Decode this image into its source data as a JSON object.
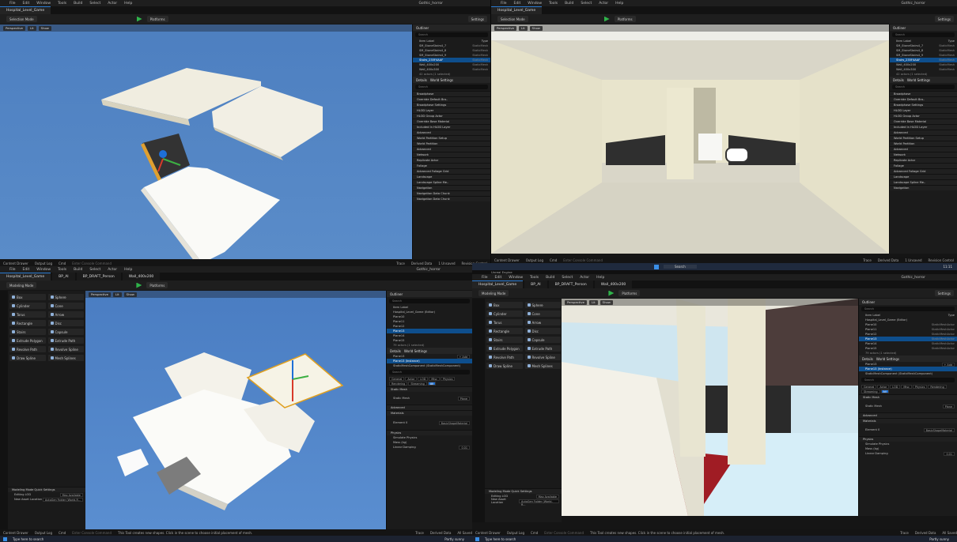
{
  "q1": {
    "menu": [
      "File",
      "Edit",
      "Window",
      "Tools",
      "Build",
      "Select",
      "Actor",
      "Help"
    ],
    "tab": "Hospital_Level_Game",
    "project": "Gothic_horror",
    "toolbar": {
      "mode": "Selection Mode",
      "platforms": "Platforms",
      "settings": "Settings"
    },
    "viewport": {
      "perspective": "Perspective",
      "lit": "Lit",
      "show": "Show"
    },
    "outliner": {
      "title": "Outliner",
      "search": "Search",
      "col_label": "Item Label",
      "col_type": "Type",
      "rows": [
        {
          "label": "SM_StoneStairs4_7",
          "type": "StaticMesh",
          "sel": false
        },
        {
          "label": "SM_StoneStairs4_8",
          "type": "StaticMesh",
          "sel": false
        },
        {
          "label": "SM_StoneStairs4_9",
          "type": "StaticMesh",
          "sel": false
        },
        {
          "label": "Stairs_235F4AAF",
          "type": "StaticMesh",
          "sel": true
        },
        {
          "label": "Wall_400x200",
          "type": "StaticMesh",
          "sel": false
        },
        {
          "label": "Wall_400x300",
          "type": "StaticMesh",
          "sel": false
        }
      ],
      "count": "42 actors (1 selected)"
    },
    "details": {
      "tab1": "Details",
      "tab2": "World Settings",
      "search": "Search",
      "sections": [
        "Broadphase",
        "Override Default Bro..",
        "Broadphase Settings",
        "HLOD Layer",
        "HLOD Group Actor",
        "Override Base Material",
        "Included In HLOD Layer",
        "Advanced",
        "World Partition Setup",
        "World Partition",
        "Advanced",
        "Network",
        "Replicate Actor",
        "Foliage",
        "Advanced Foliage Grid",
        "Landscape",
        "Landscape Spline Me..",
        "Navigation",
        "Navigation Data Chunk",
        "Navigation Data Chunk"
      ],
      "hlod_none": "None",
      "values": [
        "512000",
        "40000"
      ]
    },
    "status": [
      "Content Drawer",
      "Output Log",
      "Cmd",
      "Enter Console Command",
      "Trace",
      "Derived Data",
      "1 Unsaved",
      "Revision Control"
    ]
  },
  "q2": {
    "menu": [
      "File",
      "Edit",
      "Window",
      "Tools",
      "Build",
      "Select",
      "Actor",
      "Help"
    ],
    "tab": "Hospital_Level_Game",
    "project": "Gothic_horror",
    "toolbar": {
      "mode": "Selection Mode",
      "platforms": "Platforms",
      "settings": "Settings"
    },
    "viewport": {
      "perspective": "Perspective",
      "lit": "Lit",
      "show": "Show"
    },
    "outliner": {
      "title": "Outliner",
      "search": "Search",
      "col_label": "Item Label",
      "col_type": "Type",
      "rows": [
        {
          "label": "SM_StoneStairs4_7",
          "type": "StaticMesh",
          "sel": false
        },
        {
          "label": "SM_StoneStairs4_8",
          "type": "StaticMesh",
          "sel": false
        },
        {
          "label": "SM_StoneStairs4_9",
          "type": "StaticMesh",
          "sel": false
        },
        {
          "label": "Stairs_235F4AAF",
          "type": "StaticMesh",
          "sel": true
        },
        {
          "label": "Wall_400x200",
          "type": "StaticMesh",
          "sel": false
        },
        {
          "label": "Wall_400x300",
          "type": "StaticMesh",
          "sel": false
        }
      ],
      "count": "42 actors (1 selected)"
    },
    "details": {
      "tab1": "Details",
      "tab2": "World Settings",
      "search": "Search",
      "hlod_none": "None"
    },
    "status": [
      "Content Drawer",
      "Output Log",
      "Cmd",
      "Enter Console Command",
      "Trace",
      "Derived Data",
      "1 Unsaved",
      "Revision Control"
    ]
  },
  "q3": {
    "menu": [
      "File",
      "Edit",
      "Window",
      "Tools",
      "Build",
      "Select",
      "Actor",
      "Help"
    ],
    "tabs": [
      "Hospital_Level_Game",
      "BP_AI",
      "BP_DRAFT_Person",
      "Wall_400x200"
    ],
    "project": "Gothic_horror",
    "toolbar": {
      "mode": "Modeling Mode",
      "platforms": "Platforms"
    },
    "viewport": {
      "perspective": "Perspective",
      "lit": "Lit",
      "show": "Show"
    },
    "tools": [
      [
        "Box",
        "Sphere"
      ],
      [
        "Cylinder",
        "Cone"
      ],
      [
        "Torus",
        "Arrow"
      ],
      [
        "Rectangle",
        "Disc"
      ],
      [
        "Stairs",
        "Capsule"
      ],
      [
        "Extrude Polygon",
        "Extrude Path"
      ],
      [
        "Revolve Path",
        "Revolve Spline"
      ],
      [
        "Draw Spline",
        "Mesh Splines"
      ]
    ],
    "quick": {
      "title": "Modeling Mode Quick Settings",
      "editing": "Editing LOD",
      "editing_val": "Max Available",
      "asset": "New Asset Location",
      "asset_val": "AutoGen Folder (World-R..."
    },
    "outliner": {
      "title": "Outliner",
      "search": "Search",
      "col_label": "Item Label",
      "rows": [
        {
          "label": "Hospital_Level_Game (Editor)",
          "sel": false
        },
        {
          "label": "Plane10",
          "sel": false
        },
        {
          "label": "Plane11",
          "sel": false
        },
        {
          "label": "Plane12",
          "sel": false
        },
        {
          "label": "Plane13",
          "sel": true
        },
        {
          "label": "Plane14",
          "sel": false
        },
        {
          "label": "Plane15",
          "sel": false
        }
      ],
      "count": "79 actors (1 selected)"
    },
    "details": {
      "tab1": "Details",
      "tab2": "World Settings",
      "actor": "Plane13",
      "add": "+ Add",
      "comp1": "Plane13 (Instance)",
      "comp2": "StaticMeshComponent (StaticMeshComponent)",
      "search": "Search",
      "filters": [
        "General",
        "Actor",
        "LOD",
        "Misc",
        "Physics",
        "Rendering",
        "Streaming",
        "All"
      ],
      "static_mesh": "Static Mesh",
      "mesh_val": "Plane",
      "advanced": "Advanced",
      "materials": "Materials",
      "element": "Element 0",
      "mat_val": "BasicShapeMaterial",
      "physics": "Physics",
      "simulate": "Simulate Physics",
      "mass": "Mass (kg)",
      "damping": "Linear Damping",
      "damping_val": "0.01"
    },
    "status": [
      "Content Drawer",
      "Output Log",
      "Cmd",
      "Enter Console Command",
      "This Tool creates new shapes. Click in the scene to choose initial placement of mesh.",
      "Trace",
      "Derived Data",
      "All Saved",
      "Revision Control"
    ],
    "taskbar": [
      "Type here to search",
      "Partly sunny"
    ]
  },
  "q4": {
    "menu": [
      "File",
      "Edit",
      "Window",
      "Tools",
      "Build",
      "Select",
      "Actor",
      "Help"
    ],
    "tabs": [
      "Hospital_Level_Game",
      "BP_AI",
      "BP_DRAFT_Person",
      "Wall_400x200"
    ],
    "project": "Gothic_horror",
    "unreal": "Unreal Engine",
    "search_taskbar": "Search",
    "toolbar": {
      "mode": "Modeling Mode",
      "platforms": "Platforms",
      "settings": "Settings"
    },
    "viewport": {
      "perspective": "Perspective",
      "lit": "Lit",
      "show": "Show"
    },
    "tools": [
      [
        "Box",
        "Sphere"
      ],
      [
        "Cylinder",
        "Cone"
      ],
      [
        "Torus",
        "Arrow"
      ],
      [
        "Rectangle",
        "Disc"
      ],
      [
        "Stairs",
        "Capsule"
      ],
      [
        "Extrude Polygon",
        "Extrude Path"
      ],
      [
        "Revolve Path",
        "Revolve Spline"
      ],
      [
        "Draw Spline",
        "Mesh Splines"
      ]
    ],
    "quick": {
      "title": "Modeling Mode Quick Settings",
      "editing": "Editing LOD",
      "editing_val": "Max Available",
      "asset": "New Asset Location",
      "asset_val": "AutoGen Folder (World-R..."
    },
    "outliner": {
      "title": "Outliner",
      "search": "Search",
      "col_label": "Item Label",
      "col_type": "Type",
      "rows": [
        {
          "label": "Hospital_Level_Game (Editor)",
          "type": "",
          "sel": false
        },
        {
          "label": "Plane10",
          "type": "StaticMeshActor",
          "sel": false
        },
        {
          "label": "Plane11",
          "type": "StaticMeshActor",
          "sel": false
        },
        {
          "label": "Plane12",
          "type": "StaticMeshActor",
          "sel": false
        },
        {
          "label": "Plane13",
          "type": "StaticMeshActor",
          "sel": true
        },
        {
          "label": "Plane14",
          "type": "StaticMeshActor",
          "sel": false
        },
        {
          "label": "Plane15",
          "type": "StaticMeshActor",
          "sel": false
        }
      ],
      "count": "79 actors (1 selected)"
    },
    "details": {
      "tab1": "Details",
      "tab2": "World Settings",
      "actor": "Plane13",
      "add": "+ Add",
      "comp1": "Plane13 (Instance)",
      "comp2": "StaticMeshComponent (StaticMeshComponent)",
      "search": "Search",
      "filters": [
        "General",
        "Actor",
        "LOD",
        "Misc",
        "Physics",
        "Rendering",
        "Streaming",
        "All"
      ],
      "static_mesh": "Static Mesh",
      "mesh_val": "Plane",
      "advanced": "Advanced",
      "materials": "Materials",
      "element": "Element 0",
      "mat_val": "BasicShapeMaterial",
      "physics": "Physics",
      "simulate": "Simulate Physics",
      "mass": "Mass (kg)",
      "damping": "Linear Damping",
      "damping_val": "0.01"
    },
    "status": [
      "Content Drawer",
      "Output Log",
      "Cmd",
      "Enter Console Command",
      "This Tool creates new shapes. Click in the scene to choose initial placement of mesh.",
      "Trace",
      "Derived Data",
      "All Saved",
      "Revision Control"
    ],
    "taskbar": [
      "Type here to search",
      "Partly sunny"
    ],
    "clock": "11:11"
  }
}
